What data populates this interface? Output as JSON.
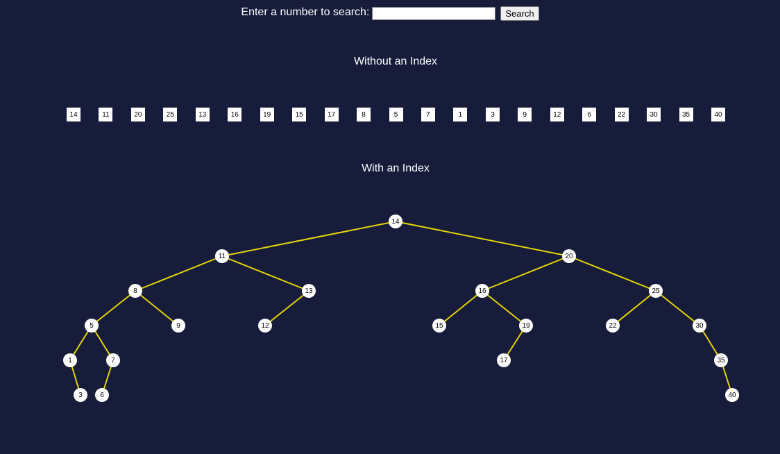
{
  "search": {
    "label": "Enter a number to search:",
    "value": "",
    "placeholder": "",
    "button_label": "Search"
  },
  "sections": {
    "without_index_title": "Without an Index",
    "with_index_title": "With an Index"
  },
  "array_values": [
    "14",
    "11",
    "20",
    "25",
    "13",
    "16",
    "19",
    "15",
    "17",
    "8",
    "5",
    "7",
    "1",
    "3",
    "9",
    "12",
    "6",
    "22",
    "30",
    "35",
    "40"
  ],
  "tree": {
    "nodes": [
      {
        "id": "n14",
        "label": "14"
      },
      {
        "id": "n11",
        "label": "11"
      },
      {
        "id": "n20",
        "label": "20"
      },
      {
        "id": "n8",
        "label": "8"
      },
      {
        "id": "n13",
        "label": "13"
      },
      {
        "id": "n16",
        "label": "16"
      },
      {
        "id": "n25",
        "label": "25"
      },
      {
        "id": "n5",
        "label": "5"
      },
      {
        "id": "n9",
        "label": "9"
      },
      {
        "id": "n12",
        "label": "12"
      },
      {
        "id": "n15",
        "label": "15"
      },
      {
        "id": "n19",
        "label": "19"
      },
      {
        "id": "n22",
        "label": "22"
      },
      {
        "id": "n30",
        "label": "30"
      },
      {
        "id": "n1",
        "label": "1"
      },
      {
        "id": "n7",
        "label": "7"
      },
      {
        "id": "n17",
        "label": "17"
      },
      {
        "id": "n35",
        "label": "35"
      },
      {
        "id": "n3",
        "label": "3"
      },
      {
        "id": "n6",
        "label": "6"
      },
      {
        "id": "n40",
        "label": "40"
      }
    ],
    "edges": [
      [
        "n14",
        "n11"
      ],
      [
        "n14",
        "n20"
      ],
      [
        "n11",
        "n8"
      ],
      [
        "n11",
        "n13"
      ],
      [
        "n20",
        "n16"
      ],
      [
        "n20",
        "n25"
      ],
      [
        "n8",
        "n5"
      ],
      [
        "n8",
        "n9"
      ],
      [
        "n13",
        "n12"
      ],
      [
        "n16",
        "n15"
      ],
      [
        "n16",
        "n19"
      ],
      [
        "n25",
        "n22"
      ],
      [
        "n25",
        "n30"
      ],
      [
        "n5",
        "n1"
      ],
      [
        "n5",
        "n7"
      ],
      [
        "n19",
        "n17"
      ],
      [
        "n30",
        "n35"
      ],
      [
        "n1",
        "n3"
      ],
      [
        "n7",
        "n6"
      ],
      [
        "n35",
        "n40"
      ]
    ],
    "edge_color": "#e5d500",
    "node_color": "#ffffff"
  },
  "colors": {
    "background": "#171c3a",
    "text": "#ffffff"
  }
}
